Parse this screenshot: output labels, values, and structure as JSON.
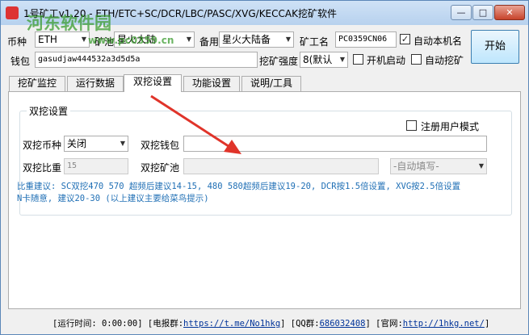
{
  "window": {
    "title": "1号矿工v1.20 - ETH/ETC+SC/DCR/LBC/PASC/XVG/KECCAK挖矿软件",
    "min_glyph": "—",
    "max_glyph": "□",
    "close_glyph": "✕"
  },
  "watermark": {
    "brand": "河东软件园",
    "url": "www.pc0359.cn"
  },
  "top": {
    "coin_label": "币种",
    "coin_value": "ETH",
    "pool_label": "矿池",
    "pool_value": "星火大陆",
    "backup_label": "备用",
    "backup_value": "星火大陆备",
    "worker_label": "矿工名",
    "worker_value": "PC0359CN06",
    "auto_name_label": "自动本机名",
    "auto_name_checked": true,
    "wallet_label": "钱包",
    "wallet_value": "gasudjaw444532a3d5d5a",
    "intensity_label": "挖矿强度",
    "intensity_value": "8(默认",
    "autostart_label": "开机启动",
    "automine_label": "自动挖矿",
    "start_button": "开始"
  },
  "tabs": [
    {
      "label": "挖矿监控",
      "active": false
    },
    {
      "label": "运行数据",
      "active": false
    },
    {
      "label": "双挖设置",
      "active": true
    },
    {
      "label": "功能设置",
      "active": false
    },
    {
      "label": "说明/工具",
      "active": false
    }
  ],
  "dual": {
    "group_title": "双挖设置",
    "register_mode_label": "注册用户模式",
    "coin_label": "双挖币种",
    "coin_value": "关闭",
    "wallet_label": "双挖钱包",
    "wallet_value": "",
    "ratio_label": "双挖比重",
    "ratio_value": "15",
    "pool_label": "双挖矿池",
    "pool_value": "",
    "pool_select": "-自动填写-",
    "advice_line1": "比重建议: SC双挖470 570 超频后建议14-15, 480 580超频后建议19-20, DCR按1.5倍设置, XVG按2.5倍设置",
    "advice_line2": "N卡随意, 建议20-30 (以上建议主要给菜鸟提示)"
  },
  "status": {
    "runtime_label": "[运行时间: ",
    "runtime_value": "0:00:00",
    "feedback_label": "] [电报群:",
    "feedback_link": "https://t.me/No1hkg",
    "qq_label": "] [QQ群:",
    "qq_value": "686032408",
    "site_label": "] [官网:",
    "site_link": "http://1hkg.net/",
    "close": "]"
  },
  "colors": {
    "annotation_arrow": "#e0342a",
    "advice_text": "#1f6fb5",
    "watermark": "#3a9c2e"
  }
}
